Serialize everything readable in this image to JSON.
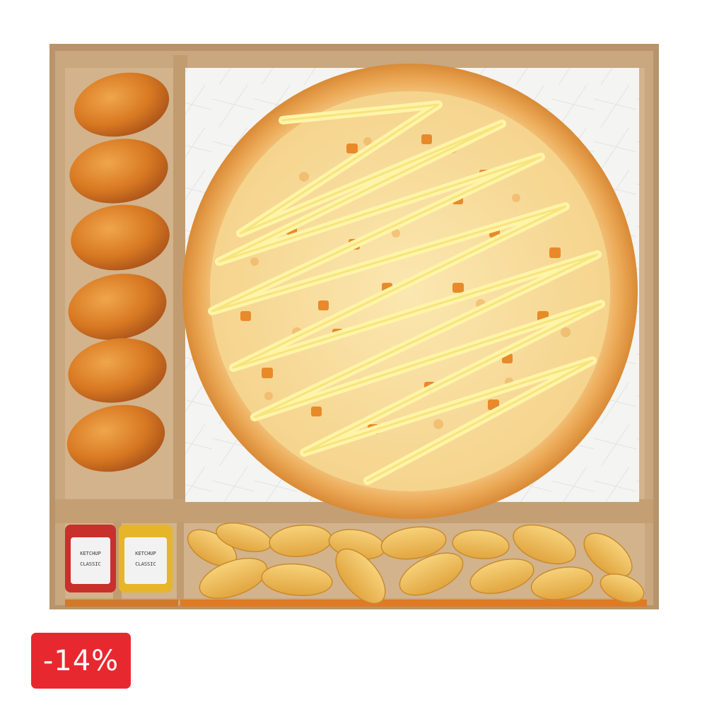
{
  "badge": {
    "discount": "-14%",
    "color": "#e8282f"
  },
  "image": {
    "alt_description_icons": [
      "box-icon",
      "pizza-icon",
      "chicken-wing-icon",
      "potato-wedge-icon",
      "sauce-cup-icon"
    ],
    "sauces": [
      {
        "color": "#c8302c",
        "label_line1": "KETCHUP",
        "label_line2": "CLASSIC"
      },
      {
        "color": "#e7b52a",
        "label_line1": "KETCHUP",
        "label_line2": "CLASSIC"
      }
    ]
  }
}
